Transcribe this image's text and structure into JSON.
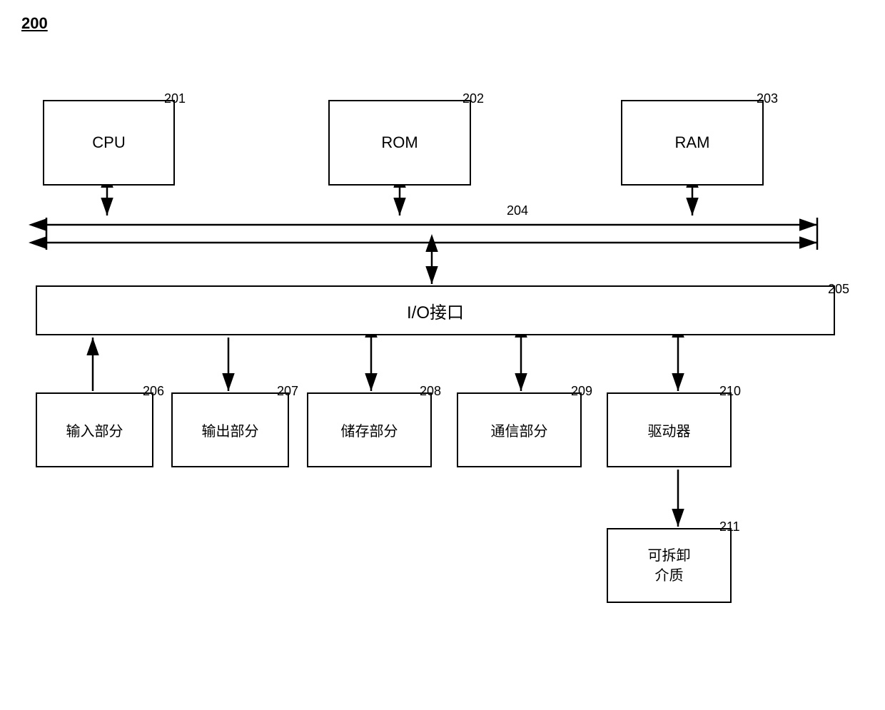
{
  "title": "200",
  "boxes": {
    "cpu": {
      "label": "CPU",
      "ref": "201"
    },
    "rom": {
      "label": "ROM",
      "ref": "202"
    },
    "ram": {
      "label": "RAM",
      "ref": "203"
    },
    "bus_ref": {
      "label": "204"
    },
    "io": {
      "label": "I/O接口",
      "ref": "205"
    },
    "input": {
      "label": "输入部分",
      "ref": "206"
    },
    "output": {
      "label": "输出部分",
      "ref": "207"
    },
    "storage": {
      "label": "储存部分",
      "ref": "208"
    },
    "comms": {
      "label": "通信部分",
      "ref": "209"
    },
    "driver": {
      "label": "驱动器",
      "ref": "210"
    },
    "removable": {
      "label": "可拆卸\n介质",
      "ref": "211"
    }
  }
}
